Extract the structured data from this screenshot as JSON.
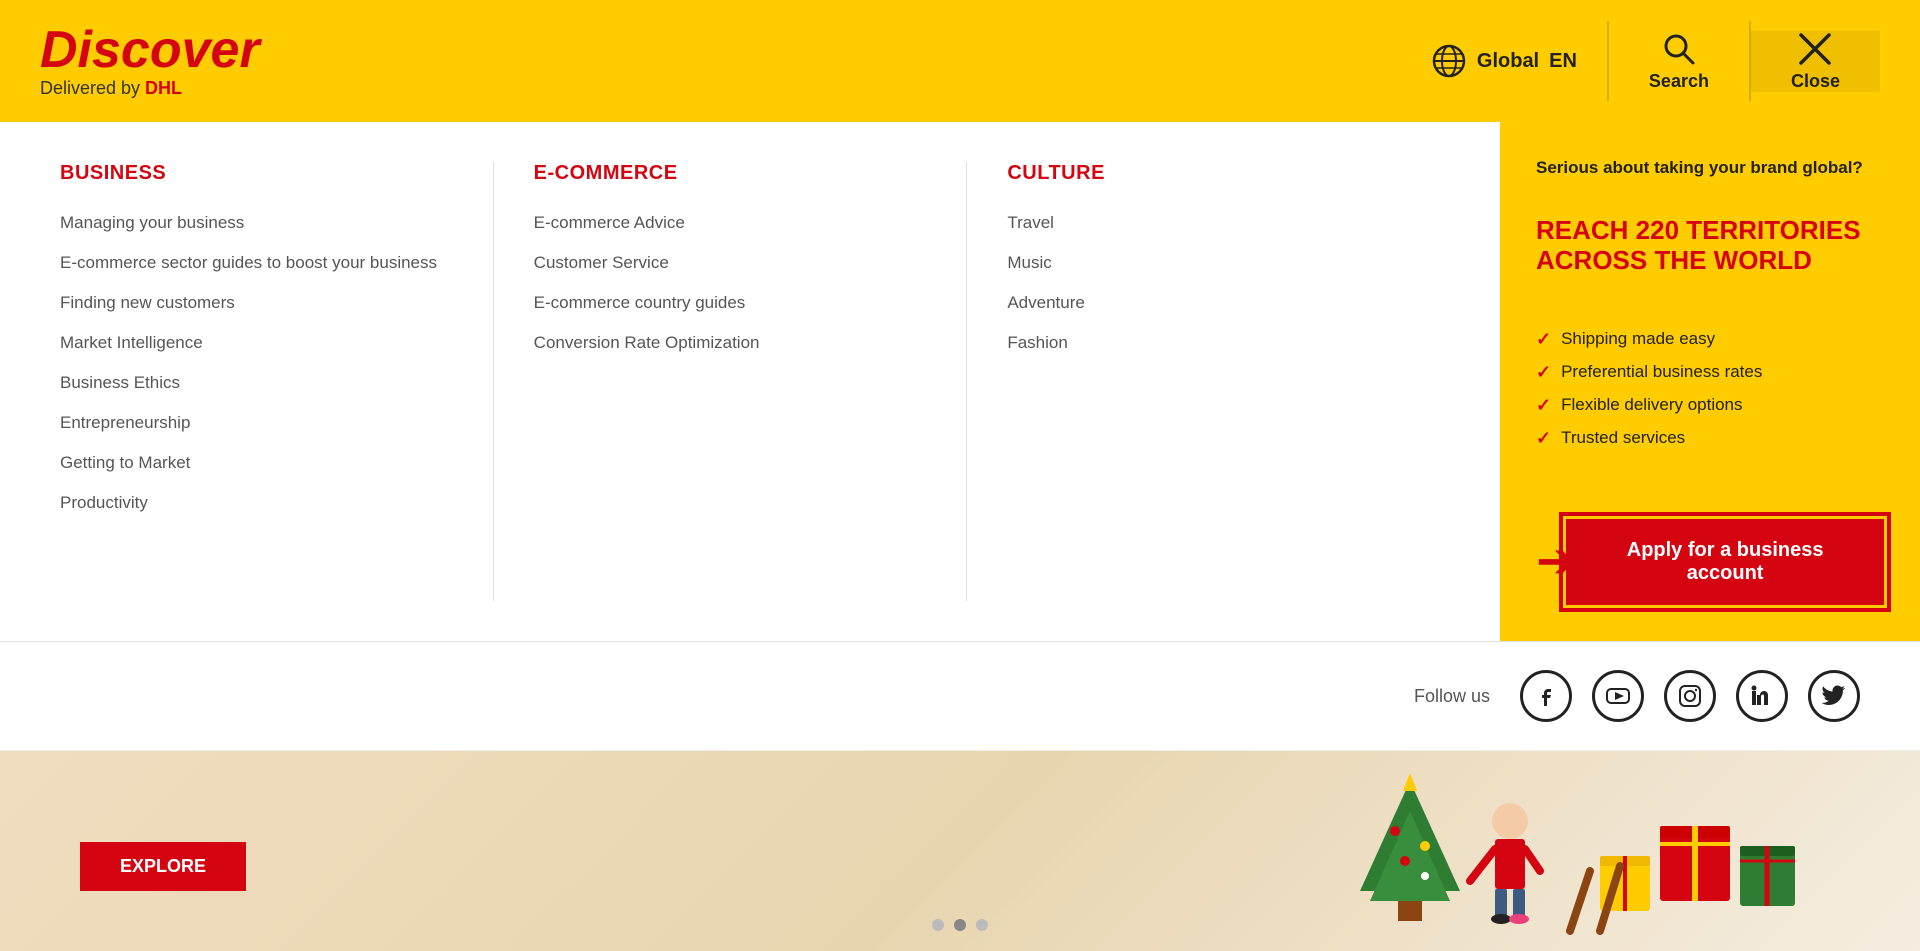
{
  "header": {
    "logo_discover": "Discover",
    "logo_sub": "Delivered by ",
    "logo_dhl": "DHL",
    "global_label": "Global",
    "lang_label": "EN",
    "search_label": "Search",
    "close_label": "Close"
  },
  "nav": {
    "columns": [
      {
        "id": "business",
        "title": "BUSINESS",
        "links": [
          "Managing your business",
          "E-commerce sector guides to boost your business",
          "Finding new customers",
          "Market Intelligence",
          "Business Ethics",
          "Entrepreneurship",
          "Getting to Market",
          "Productivity"
        ]
      },
      {
        "id": "ecommerce",
        "title": "E-COMMERCE",
        "links": [
          "E-commerce Advice",
          "Customer Service",
          "E-commerce country guides",
          "Conversion Rate Optimization"
        ]
      },
      {
        "id": "culture",
        "title": "CULTURE",
        "links": [
          "Travel",
          "Music",
          "Adventure",
          "Fashion"
        ]
      }
    ]
  },
  "promo": {
    "subtitle": "Serious about taking your brand global?",
    "title": "REACH 220 TERRITORIES ACROSS THE WORLD",
    "checklist": [
      "Shipping made easy",
      "Preferential business rates",
      "Flexible delivery options",
      "Trusted services"
    ],
    "cta_label": "Apply for a business account"
  },
  "social": {
    "follow_label": "Follow us",
    "platforms": [
      "facebook",
      "youtube",
      "instagram",
      "linkedin",
      "twitter"
    ]
  }
}
